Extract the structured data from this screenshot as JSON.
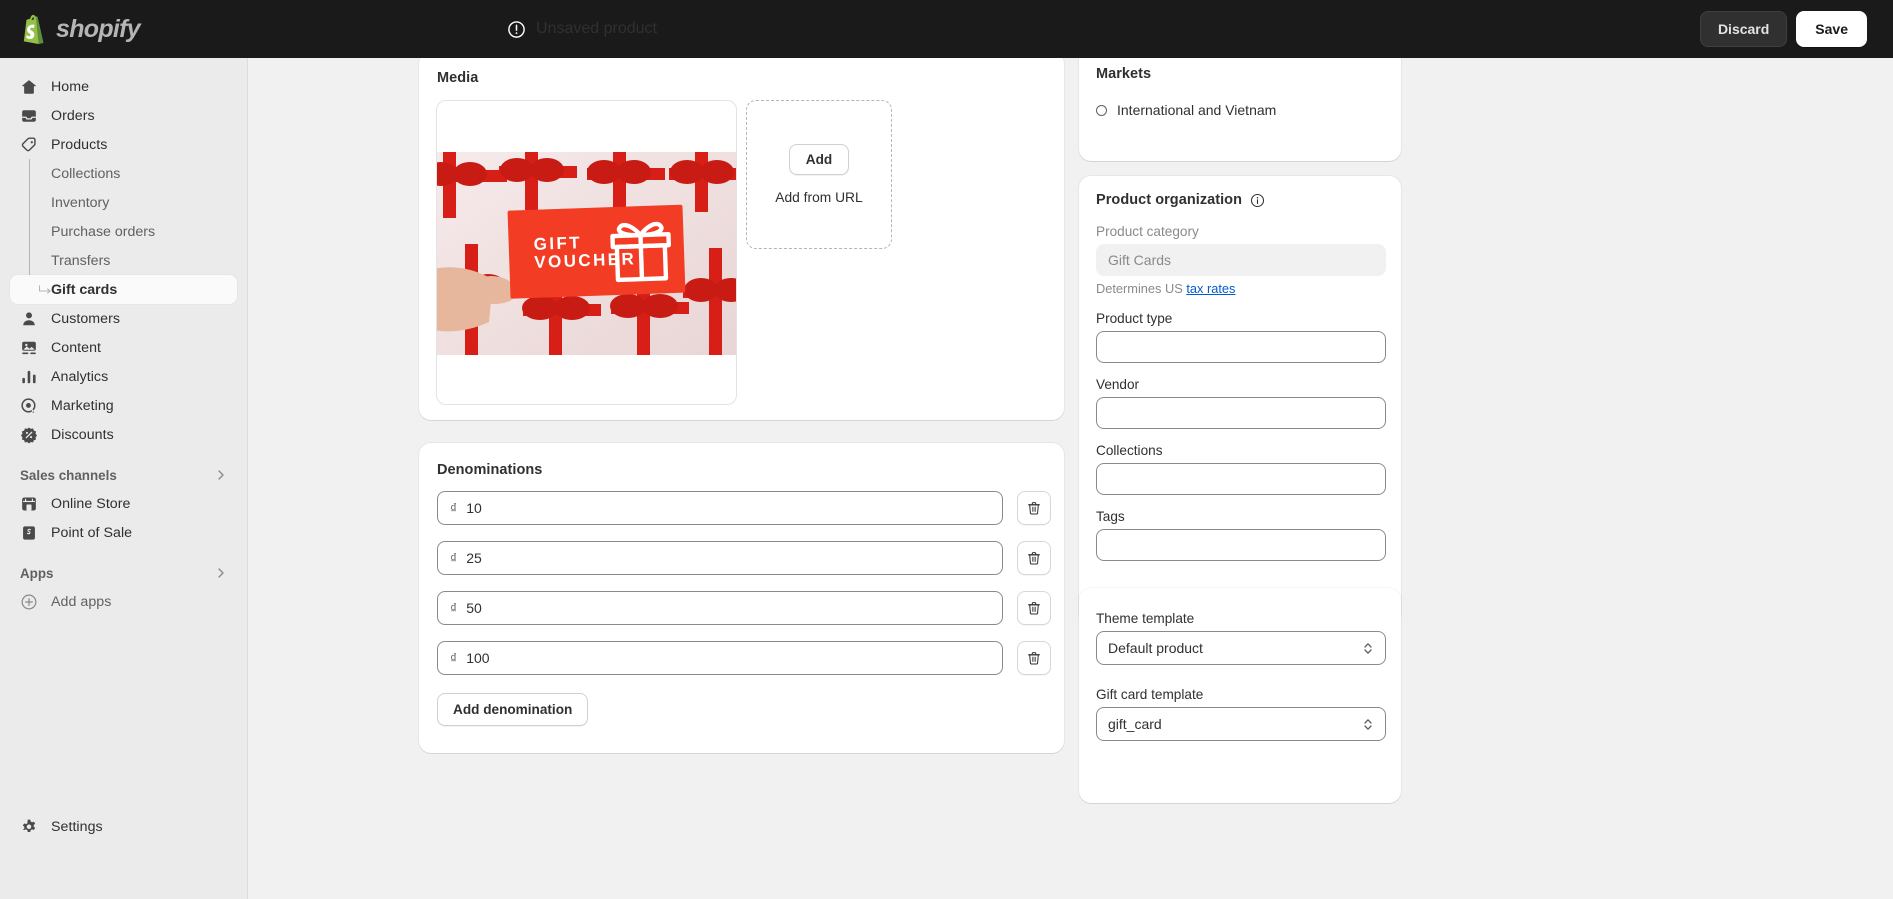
{
  "topbar": {
    "brand_name": "shopify",
    "status_text": "Unsaved product",
    "status_icon": "alert-circle-icon",
    "discard_label": "Discard",
    "save_label": "Save"
  },
  "sidebar": {
    "primary": [
      {
        "label": "Home",
        "icon": "home-icon"
      },
      {
        "label": "Orders",
        "icon": "orders-inbox-icon"
      },
      {
        "label": "Products",
        "icon": "product-tag-icon"
      }
    ],
    "products_sub": [
      {
        "label": "Collections",
        "active": false
      },
      {
        "label": "Inventory",
        "active": false
      },
      {
        "label": "Purchase orders",
        "active": false
      },
      {
        "label": "Transfers",
        "active": false
      },
      {
        "label": "Gift cards",
        "active": true
      }
    ],
    "secondary": [
      {
        "label": "Customers",
        "icon": "customer-person-icon"
      },
      {
        "label": "Content",
        "icon": "content-image-icon"
      },
      {
        "label": "Analytics",
        "icon": "analytics-bars-icon"
      },
      {
        "label": "Marketing",
        "icon": "marketing-target-icon"
      },
      {
        "label": "Discounts",
        "icon": "discount-badge-icon"
      }
    ],
    "sales_channels_header": "Sales channels",
    "sales_channels": [
      {
        "label": "Online Store",
        "icon": "storefront-icon"
      },
      {
        "label": "Point of Sale",
        "icon": "point-of-sale-icon"
      }
    ],
    "apps_header": "Apps",
    "apps": [
      {
        "label": "Add apps",
        "icon": "plus-circle-icon"
      }
    ],
    "settings": {
      "label": "Settings",
      "icon": "gear-icon"
    }
  },
  "media": {
    "title": "Media",
    "thumbnail_alt": "gift-voucher-photo",
    "thumbnail_caption_line1": "GIFT",
    "thumbnail_caption_line2": "VOUCHER",
    "add_label": "Add",
    "add_from_url_label": "Add from URL"
  },
  "denominations": {
    "title": "Denominations",
    "currency_symbol": "₫",
    "rows": [
      {
        "value": "10"
      },
      {
        "value": "25"
      },
      {
        "value": "50"
      },
      {
        "value": "100"
      }
    ],
    "delete_icon": "trash-icon",
    "add_label": "Add denomination"
  },
  "markets": {
    "title": "Markets",
    "entry_label": "International and Vietnam",
    "entry_icon": "globe-circle-icon"
  },
  "organization": {
    "title": "Product organization",
    "info_icon": "info-icon",
    "category_label": "Product category",
    "category_value": "Gift Cards",
    "helper_prefix": "Determines US ",
    "helper_link": "tax rates",
    "fields": [
      {
        "label": "Product type",
        "value": ""
      },
      {
        "label": "Vendor",
        "value": ""
      },
      {
        "label": "Collections",
        "value": ""
      },
      {
        "label": "Tags",
        "value": ""
      }
    ]
  },
  "theme": {
    "template_label": "Theme template",
    "template_value": "Default product",
    "giftcard_label": "Gift card template",
    "giftcard_value": "gift_card",
    "chevron_icon": "select-chevron-icon"
  },
  "colors": {
    "topbar_bg": "#1a1a1a",
    "sidebar_bg": "#ebebeb",
    "page_bg": "#f1f1f1",
    "card_bg": "#ffffff",
    "link": "#005bd3",
    "accent_red": "#f23c24"
  }
}
